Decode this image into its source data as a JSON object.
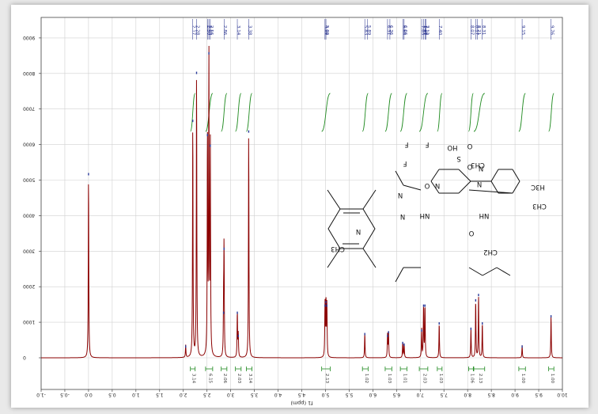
{
  "chart_data": {
    "type": "line",
    "orientation": "rotated-180",
    "xlabel": "f1 (ppm)",
    "xlim": [
      -1.0,
      10.0
    ],
    "ylim": [
      -800,
      9600
    ],
    "x_ticks": [
      -1.0,
      -0.5,
      0.0,
      0.5,
      1.0,
      1.5,
      2.0,
      2.5,
      3.0,
      3.5,
      4.0,
      4.5,
      5.0,
      5.5,
      6.0,
      6.5,
      7.0,
      7.5,
      8.0,
      8.5,
      9.0,
      9.5,
      10.0
    ],
    "x_tick_labels": [
      "-1.0",
      "-0.5",
      "0.0",
      "0.5",
      "1.0",
      "1.5",
      "2.0",
      "2.5",
      "3.0",
      "3.5",
      "4.0",
      "4.5",
      "5.0",
      "5.5",
      "6.0",
      "6.5",
      "7.0",
      "7.5",
      "8.0",
      "8.5",
      "9.0",
      "9.5",
      "10.0"
    ],
    "y_ticks": [
      0,
      1000,
      2000,
      3000,
      4000,
      5000,
      6000,
      7000,
      8000,
      9000
    ],
    "y_tick_labels": [
      "0",
      "1000",
      "2000",
      "3000",
      "4000",
      "5000",
      "6000",
      "7000",
      "8000",
      "9000"
    ],
    "grid": true,
    "line_color": "#8b0000",
    "marker_color": "#2a3a9a",
    "integral_color": "#1f8a1f",
    "peaks": [
      {
        "x": 0.0,
        "h": 5200
      },
      {
        "x": 2.05,
        "h": 350
      },
      {
        "x": 2.2,
        "h": 6700
      },
      {
        "x": 2.28,
        "h": 8050
      },
      {
        "x": 2.51,
        "h": 6300
      },
      {
        "x": 2.54,
        "h": 8600
      },
      {
        "x": 2.57,
        "h": 6000
      },
      {
        "x": 2.85,
        "h": 1300
      },
      {
        "x": 2.86,
        "h": 3100
      },
      {
        "x": 3.14,
        "h": 1300
      },
      {
        "x": 3.16,
        "h": 650
      },
      {
        "x": 3.38,
        "h": 6400
      },
      {
        "x": 4.99,
        "h": 1500
      },
      {
        "x": 5.01,
        "h": 1600
      },
      {
        "x": 5.03,
        "h": 1500
      },
      {
        "x": 5.83,
        "h": 700
      },
      {
        "x": 6.31,
        "h": 650
      },
      {
        "x": 6.33,
        "h": 750
      },
      {
        "x": 6.63,
        "h": 450
      },
      {
        "x": 6.66,
        "h": 400
      },
      {
        "x": 7.03,
        "h": 800
      },
      {
        "x": 7.07,
        "h": 1500
      },
      {
        "x": 7.1,
        "h": 1500
      },
      {
        "x": 7.4,
        "h": 1000
      },
      {
        "x": 8.07,
        "h": 850
      },
      {
        "x": 8.17,
        "h": 1650
      },
      {
        "x": 8.23,
        "h": 1800
      },
      {
        "x": 8.31,
        "h": 1000
      },
      {
        "x": 9.15,
        "h": 350
      },
      {
        "x": 9.76,
        "h": 1200
      }
    ],
    "peak_labels": [
      {
        "x": 2.2,
        "text": "2.17"
      },
      {
        "x": 2.28,
        "text": "2.28"
      },
      {
        "x": 2.51,
        "text": "2.50"
      },
      {
        "x": 2.54,
        "text": "2.53"
      },
      {
        "x": 2.57,
        "text": "2.56"
      },
      {
        "x": 2.86,
        "text": "2.86"
      },
      {
        "x": 3.14,
        "text": "3.14"
      },
      {
        "x": 3.38,
        "text": "3.38"
      },
      {
        "x": 4.99,
        "text": "4.99"
      },
      {
        "x": 5.01,
        "text": "5.02"
      },
      {
        "x": 5.83,
        "text": "5.83"
      },
      {
        "x": 5.89,
        "text": "5.89"
      },
      {
        "x": 6.31,
        "text": "6.31"
      },
      {
        "x": 6.36,
        "text": "6.36"
      },
      {
        "x": 6.64,
        "text": "6.64"
      },
      {
        "x": 6.66,
        "text": "6.66"
      },
      {
        "x": 7.03,
        "text": "7.03"
      },
      {
        "x": 7.07,
        "text": "7.07"
      },
      {
        "x": 7.1,
        "text": "7.10"
      },
      {
        "x": 7.12,
        "text": "7.12"
      },
      {
        "x": 7.4,
        "text": "7.40"
      },
      {
        "x": 8.07,
        "text": "8.07"
      },
      {
        "x": 8.17,
        "text": "8.17"
      },
      {
        "x": 8.21,
        "text": "8.21"
      },
      {
        "x": 8.31,
        "text": "8.31"
      },
      {
        "x": 9.15,
        "text": "9.15"
      },
      {
        "x": 9.76,
        "text": "9.76"
      }
    ],
    "integrals": [
      {
        "x1": 2.15,
        "x2": 2.25,
        "text": "3.14"
      },
      {
        "x1": 2.47,
        "x2": 2.62,
        "text": "6.15"
      },
      {
        "x1": 2.8,
        "x2": 2.92,
        "text": "2.06"
      },
      {
        "x1": 3.1,
        "x2": 3.22,
        "text": "2.03"
      },
      {
        "x1": 3.33,
        "x2": 3.45,
        "text": "3.14"
      },
      {
        "x1": 4.92,
        "x2": 5.1,
        "text": "2.13"
      },
      {
        "x1": 5.78,
        "x2": 5.9,
        "text": "1.02"
      },
      {
        "x1": 6.26,
        "x2": 6.4,
        "text": "1.03"
      },
      {
        "x1": 6.58,
        "x2": 6.72,
        "text": "1.01"
      },
      {
        "x1": 6.98,
        "x2": 7.16,
        "text": "2.03"
      },
      {
        "x1": 7.36,
        "x2": 7.46,
        "text": "1.03"
      },
      {
        "x1": 8.02,
        "x2": 8.12,
        "text": "1.06"
      },
      {
        "x1": 8.13,
        "x2": 8.36,
        "text": "2.13"
      },
      {
        "x1": 9.08,
        "x2": 9.22,
        "text": "1.00"
      },
      {
        "x1": 9.71,
        "x2": 9.82,
        "text": "1.00"
      }
    ]
  },
  "molecule": {
    "atom_labels": {
      "f1": "F",
      "f2": "F",
      "f3": "F",
      "o_ether": "O",
      "ho_sulfonic": "HO",
      "s": "S",
      "o_s1": "O",
      "o_s2": "O",
      "ch3_mesylate": "CH3",
      "n_pyr1": "N",
      "n_pyr2": "N",
      "n_amine": "N",
      "h3c": "H3C",
      "ch3_nme2": "CH3",
      "nh_amide": "NH",
      "o_amide": "O",
      "ch2": "CH2",
      "nh_link": "NH",
      "n_pym1": "N",
      "n_pym2": "N",
      "n_indole": "N",
      "ch3_indole": "CH3"
    }
  }
}
